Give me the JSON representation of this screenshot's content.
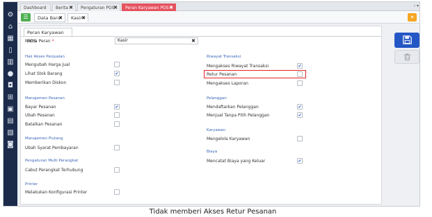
{
  "top_tabs": [
    {
      "label": "Dashboard",
      "closable": false,
      "active": false
    },
    {
      "label": "Berita",
      "closable": true,
      "active": false
    },
    {
      "label": "Pengaturan POS",
      "closable": true,
      "active": false
    },
    {
      "label": "Peran Karyawan POS",
      "closable": true,
      "active": true
    }
  ],
  "top_tab_close": "✖",
  "tabs_menu_indicator": "‹ ▾",
  "sub_tabs": [
    {
      "label": "Data Baru",
      "closable": true,
      "active": false
    },
    {
      "label": "Kasir",
      "closable": true,
      "active": true
    }
  ],
  "content_tab": "Peran Karyawan POS",
  "role": {
    "label": "Nama Peran",
    "required_mark": "*",
    "value": "Kasir",
    "clear_glyph": "✖"
  },
  "left_column": [
    {
      "title": "Hak Akses Penjualan",
      "items": [
        {
          "label": "Mengubah Harga Jual",
          "checked": false
        },
        {
          "label": "Lihat Stok Barang",
          "checked": true
        },
        {
          "label": "Memberikan Diskon",
          "checked": false
        }
      ]
    },
    {
      "title": "Manajemen Pesanan",
      "items": [
        {
          "label": "Bayar Pesanan",
          "checked": true
        },
        {
          "label": "Ubah Pesanan",
          "checked": false
        },
        {
          "label": "Batalkan Pesanan",
          "checked": false
        }
      ]
    },
    {
      "title": "Manajemen Piutang",
      "items": [
        {
          "label": "Ubah Syarat Pembayaran",
          "checked": false
        }
      ]
    },
    {
      "title": "Pengaturan Multi Perangkat",
      "items": [
        {
          "label": "Cabut Perangkat Terhubung",
          "checked": false
        }
      ]
    },
    {
      "title": "Printer",
      "items": [
        {
          "label": "Melakukan Konfigurasi Printer",
          "checked": false
        }
      ]
    }
  ],
  "right_column": [
    {
      "title": "Riwayat Transaksi",
      "items": [
        {
          "label": "Mengakses Riwayat Transaksi",
          "checked": true
        },
        {
          "label": "Retur Pesanan",
          "checked": false,
          "highlighted": true
        },
        {
          "label": "Mengakses Laporan",
          "checked": false
        }
      ]
    },
    {
      "title": "Pelanggan",
      "items": [
        {
          "label": "Mendaftarkan Pelanggan",
          "checked": true
        },
        {
          "label": "Menjual Tanpa Pilih Pelanggan",
          "checked": true
        }
      ]
    },
    {
      "title": "Karyawan",
      "items": [
        {
          "label": "Mengelola Karyawan",
          "checked": false
        }
      ]
    },
    {
      "title": "Biaya",
      "items": [
        {
          "label": "Mencatat Biaya yang Keluar",
          "checked": true
        }
      ]
    }
  ],
  "check_glyph": "✔",
  "caption": "Tidak memberi Akses Retur Pesanan",
  "colors": {
    "sidebar": "#1c2b4a",
    "active_tab": "#e5535f",
    "accent_blue": "#2457c5",
    "section_title": "#3b66b5",
    "highlight": "#e02424",
    "green": "#4caf50",
    "orange": "#f5a623"
  },
  "sidebar_icons": [
    "gear-icon",
    "bank-icon",
    "store-icon",
    "phone-icon",
    "building-icon",
    "moneybag-icon",
    "bag-icon",
    "cart-icon",
    "truck-icon",
    "chart-icon",
    "report-icon",
    "receipt-icon"
  ]
}
